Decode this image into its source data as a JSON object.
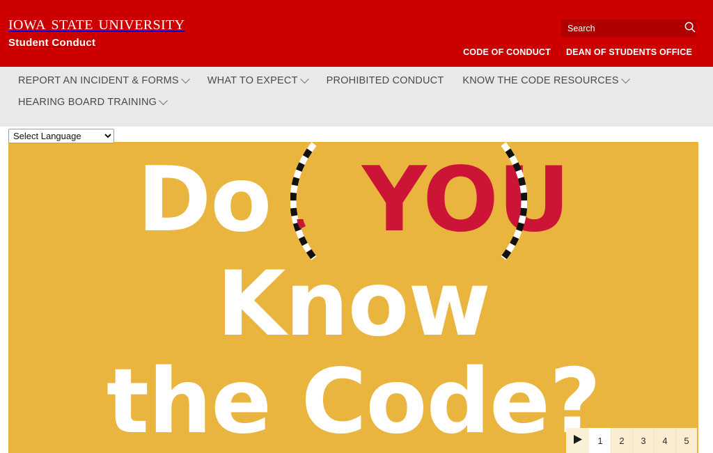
{
  "masthead": {
    "wordmark": "Iowa State University",
    "subtitle": "Student Conduct",
    "search": {
      "placeholder": "Search",
      "value": "",
      "icon": "search-icon"
    },
    "utility_links": [
      {
        "label": "CODE OF CONDUCT"
      },
      {
        "label": "DEAN OF STUDENTS OFFICE"
      }
    ],
    "background_color": "#cc0000"
  },
  "main_nav": {
    "background_color": "#e9e9e9",
    "items": [
      {
        "label": "REPORT AN INCIDENT & FORMS",
        "has_dropdown": true
      },
      {
        "label": "WHAT TO EXPECT",
        "has_dropdown": true
      },
      {
        "label": "PROHIBITED CONDUCT",
        "has_dropdown": false
      },
      {
        "label": "KNOW THE CODE RESOURCES",
        "has_dropdown": true
      },
      {
        "label": "HEARING BOARD TRAINING",
        "has_dropdown": true
      }
    ]
  },
  "language_selector": {
    "selected": "Select Language",
    "options": [
      "Select Language"
    ]
  },
  "hero": {
    "background_color": "#eab53f",
    "line1_prefix": "Do",
    "line1_highlight": "YOU",
    "line1_highlight_color": "#cc1436",
    "line2": "Know",
    "line3": "the Code?",
    "text_color": "#ffffff",
    "decoration": "dashed-parenthesis"
  },
  "pagination": {
    "play_icon": "play-icon",
    "pages": [
      "1",
      "2",
      "3",
      "4",
      "5"
    ],
    "active_page": "1"
  }
}
